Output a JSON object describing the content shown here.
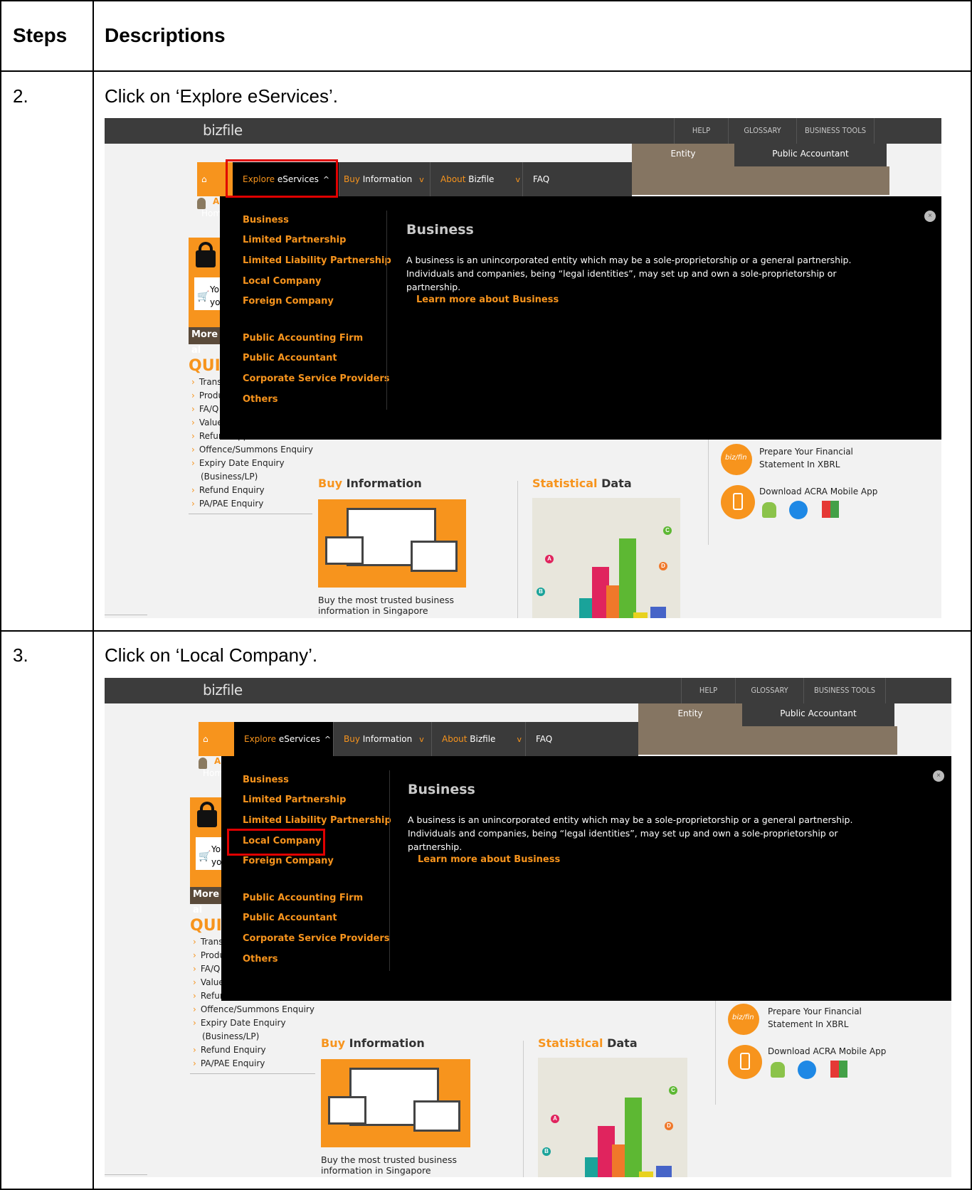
{
  "table": {
    "col_steps": "Steps",
    "col_descriptions": "Descriptions",
    "rows": [
      {
        "step": "2.",
        "description": "Click on ‘Explore eServices’."
      },
      {
        "step": "3.",
        "description": "Click on ‘Local Company’."
      }
    ]
  },
  "site": {
    "logo": "bizfile",
    "top_links": [
      "HELP",
      "GLOSSARY",
      "BUSINESS TOOLS"
    ],
    "role_tabs": [
      "Entity",
      "Public Accountant"
    ],
    "nav": {
      "home": "Home",
      "explore_a": "Explore",
      "explore_b": " eServices",
      "buy_a": "Buy",
      "buy_b": " Information",
      "about_a": "About",
      "about_b": " Bizfile",
      "faq": "FAQ"
    },
    "mega_menu": {
      "items_group1": [
        "Business",
        "Limited Partnership",
        "Limited Liability Partnership",
        "Local Company",
        "Foreign Company"
      ],
      "items_group2": [
        "Public Accounting Firm",
        "Public Accountant",
        "Corporate Service Providers",
        "Others"
      ],
      "title": "Business",
      "text_line1": "A business is an unincorporated entity which may be a sole-proprietorship or a general partnership.",
      "text_line2": "Individuals and companies, being “legal identities”, may set up and own a sole-proprietorship or",
      "text_line3": "partnership.",
      "learn_more": "Learn more about Business"
    },
    "sidebar": {
      "ann": "ANN",
      "cart_text_a": "Yo",
      "cart_text_b": "yo",
      "more": "More al",
      "quick": "QUIC",
      "quick_links": [
        "Trans",
        "Produ",
        "FA/Q",
        "Value Added Service",
        "Refund Application",
        "Offence/Summons Enquiry",
        "Expiry Date Enquiry",
        "(Business/LP)",
        "Refund Enquiry",
        "PA/PAE Enquiry"
      ]
    },
    "buy_section": {
      "title_a": "Buy",
      "title_b": " Information",
      "caption_line1": "Buy the most trusted business",
      "caption_line2": "information in Singapore"
    },
    "stat_section": {
      "title_a": "Statistical",
      "title_b": " Data",
      "bubbles": [
        "A",
        "B",
        "C",
        "D"
      ]
    },
    "right_panel": {
      "xbrl_line1": "Prepare Your Financial",
      "xbrl_line2": "Statement In XBRL",
      "xbrl_badge": "biz/fin",
      "mobile_app": "Download ACRA Mobile App"
    }
  },
  "colors": {
    "accent": "#f7941d",
    "highlight": "#e00000",
    "topbar": "#3c3c3c",
    "brown": "#857562"
  }
}
